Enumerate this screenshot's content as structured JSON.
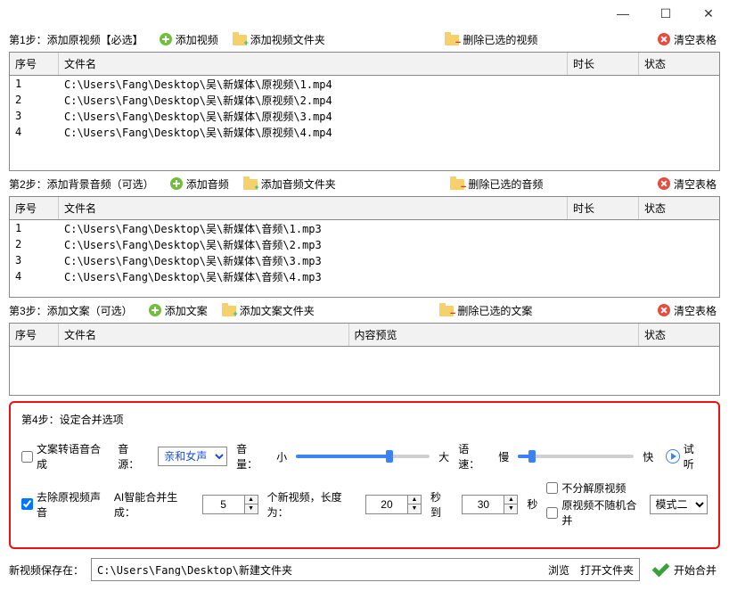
{
  "step1": {
    "label": "第1步：添加原视频【必选】",
    "btn_add": "添加视频",
    "btn_add_folder": "添加视频文件夹",
    "btn_delete": "删除已选的视频",
    "btn_clear": "清空表格",
    "cols": {
      "seq": "序号",
      "name": "文件名",
      "dur": "时长",
      "stat": "状态"
    },
    "rows": [
      {
        "seq": "1",
        "name": "C:\\Users\\Fang\\Desktop\\吴\\新媒体\\原视频\\1.mp4",
        "dur": "",
        "stat": ""
      },
      {
        "seq": "2",
        "name": "C:\\Users\\Fang\\Desktop\\吴\\新媒体\\原视频\\2.mp4",
        "dur": "",
        "stat": ""
      },
      {
        "seq": "3",
        "name": "C:\\Users\\Fang\\Desktop\\吴\\新媒体\\原视频\\3.mp4",
        "dur": "",
        "stat": ""
      },
      {
        "seq": "4",
        "name": "C:\\Users\\Fang\\Desktop\\吴\\新媒体\\原视频\\4.mp4",
        "dur": "",
        "stat": ""
      }
    ]
  },
  "step2": {
    "label": "第2步：添加背景音频（可选）",
    "btn_add": "添加音频",
    "btn_add_folder": "添加音频文件夹",
    "btn_delete": "删除已选的音频",
    "btn_clear": "清空表格",
    "cols": {
      "seq": "序号",
      "name": "文件名",
      "dur": "时长",
      "stat": "状态"
    },
    "rows": [
      {
        "seq": "1",
        "name": "C:\\Users\\Fang\\Desktop\\吴\\新媒体\\音频\\1.mp3",
        "dur": "",
        "stat": ""
      },
      {
        "seq": "2",
        "name": "C:\\Users\\Fang\\Desktop\\吴\\新媒体\\音频\\2.mp3",
        "dur": "",
        "stat": ""
      },
      {
        "seq": "3",
        "name": "C:\\Users\\Fang\\Desktop\\吴\\新媒体\\音频\\3.mp3",
        "dur": "",
        "stat": ""
      },
      {
        "seq": "4",
        "name": "C:\\Users\\Fang\\Desktop\\吴\\新媒体\\音频\\4.mp3",
        "dur": "",
        "stat": ""
      }
    ]
  },
  "step3": {
    "label": "第3步：添加文案（可选）",
    "btn_add": "添加文案",
    "btn_add_folder": "添加文案文件夹",
    "btn_delete": "删除已选的文案",
    "btn_clear": "清空表格",
    "cols": {
      "seq": "序号",
      "name": "文件名",
      "prev": "内容预览",
      "stat": "状态"
    },
    "rows": []
  },
  "step4": {
    "title": "第4步：设定合并选项",
    "tts_label": "文案转语音合成",
    "tts_checked": false,
    "voice_label": "音源：",
    "voice_value": "亲和女声",
    "vol_label": "音量：",
    "vol_min": "小",
    "vol_max": "大",
    "vol_percent": 70,
    "speed_label": "语速：",
    "speed_min": "慢",
    "speed_max": "快",
    "speed_percent": 12,
    "preview_label": "试听",
    "remove_orig_label": "去除原视频声音",
    "remove_orig_checked": true,
    "ai_merge_label": "AI智能合并生成：",
    "count_value": "5",
    "count_suffix": "个新视频，长度为：",
    "len_from": "20",
    "len_mid": "秒 到",
    "len_to": "30",
    "len_suffix": "秒",
    "nosplit_label": "不分解原视频",
    "nosplit_checked": false,
    "norandom_label": "原视频不随机合并",
    "norandom_checked": false,
    "mode_value": "模式二"
  },
  "bottom": {
    "save_label": "新视频保存在：",
    "path": "C:\\Users\\Fang\\Desktop\\新建文件夹",
    "browse": "浏览",
    "open_folder": "打开文件夹",
    "start": "开始合并"
  }
}
